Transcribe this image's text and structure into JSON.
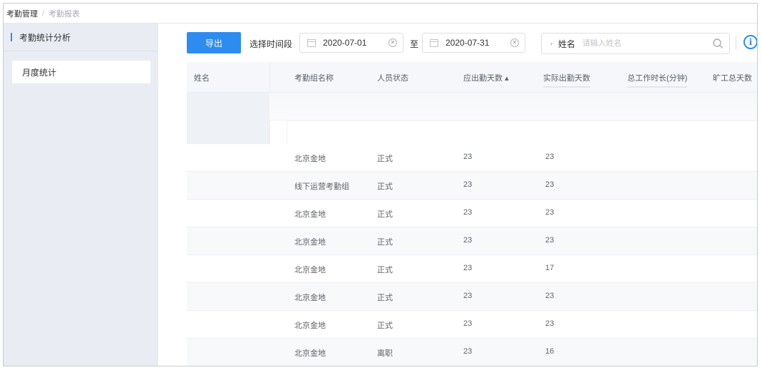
{
  "breadcrumb": {
    "first": "考勤管理",
    "separator": "/",
    "current": "考勤报表"
  },
  "sidebar": {
    "title": "考勤统计分析",
    "items": [
      {
        "label": "月度统计"
      }
    ]
  },
  "toolbar": {
    "export_label": "导出",
    "range_label": "选择时间段",
    "start_date": "2020-07-01",
    "to_label": "至",
    "end_date": "2020-07-31",
    "search_field": "姓名",
    "search_placeholder": "请输入姓名",
    "search_icon": "search-icon",
    "info_icon": "info-icon",
    "accent_color": "#2d8cf0"
  },
  "table": {
    "headers": [
      "姓名",
      "考勤组名称",
      "人员状态",
      "应出勤天数",
      "实际出勤天数",
      "总工作时长(分钟)",
      "旷工总天数"
    ],
    "sort_indicator": "▴",
    "rows": [
      {
        "group": "北京金地",
        "status": "正式",
        "expected": "23",
        "actual": "23"
      },
      {
        "group": "线下运营考勤组",
        "status": "正式",
        "expected": "23",
        "actual": "23"
      },
      {
        "group": "北京金地",
        "status": "正式",
        "expected": "23",
        "actual": "23"
      },
      {
        "group": "北京金地",
        "status": "正式",
        "expected": "23",
        "actual": "23"
      },
      {
        "group": "北京金地",
        "status": "正式",
        "expected": "23",
        "actual": "17"
      },
      {
        "group": "北京金地",
        "status": "正式",
        "expected": "23",
        "actual": "23"
      },
      {
        "group": "北京金地",
        "status": "正式",
        "expected": "23",
        "actual": "23"
      },
      {
        "group": "北京金地",
        "status": "离职",
        "expected": "23",
        "actual": "16"
      }
    ]
  }
}
